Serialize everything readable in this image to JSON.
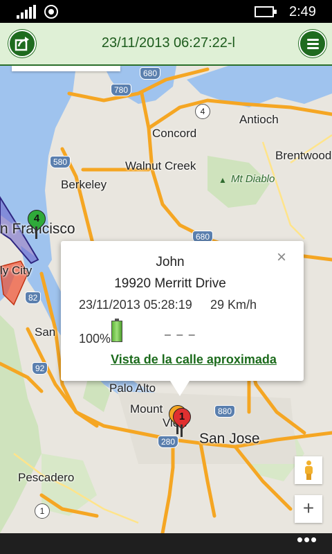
{
  "status_bar": {
    "time": "2:49"
  },
  "header": {
    "title": "23/11/2013 06:27:22-l"
  },
  "map": {
    "cities": [
      {
        "name": "Concord"
      },
      {
        "name": "Antioch"
      },
      {
        "name": "Brentwood"
      },
      {
        "name": "Walnut Creek"
      },
      {
        "name": "Berkeley"
      },
      {
        "name": "n Francisco"
      },
      {
        "name": "ly City"
      },
      {
        "name": "San"
      },
      {
        "name": "Palo Alto"
      },
      {
        "name": "Mount"
      },
      {
        "name": "View"
      },
      {
        "name": "San Jose"
      },
      {
        "name": "Pescadero"
      }
    ],
    "park_label": "Mt Diablo",
    "shields": [
      "780",
      "680",
      "580",
      "4",
      "680",
      "82",
      "92",
      "880",
      "280",
      "1"
    ],
    "markers": [
      {
        "number": "4",
        "color": "#2faa3a"
      },
      {
        "number": "1",
        "color": "#e03030"
      }
    ]
  },
  "popup": {
    "close": "×",
    "name": "John",
    "address": "19920 Merritt Drive",
    "datetime": "23/11/2013 05:28:19",
    "speed": "29 Km/h",
    "battery_percent": "100%",
    "dashes": "–   –   –",
    "street_view_link": "Vista de la calle aproximada"
  },
  "map_controls": {
    "zoom_in": "+"
  },
  "app_bar": {
    "more": "•••"
  }
}
